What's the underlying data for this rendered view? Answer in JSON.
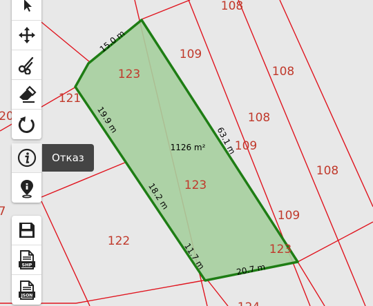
{
  "map": {
    "parcel_labels": [
      "108",
      "109",
      "108",
      "108",
      "109",
      "108",
      "109",
      "123",
      "121",
      "20",
      "123",
      "122",
      "7",
      "123",
      "124"
    ],
    "selected_parcel": {
      "area": "1126 m²",
      "edge_lengths": [
        "15.0 m",
        "19.9 m",
        "18.2 m",
        "11.7 m",
        "20.7 m",
        "63.1 m"
      ],
      "fill_color": "#a6cf9e",
      "outline_color": "#1e7d14"
    },
    "parcel_line_color": "#e0141e",
    "label_color": "#c0392b"
  },
  "toolbar": {
    "edit_tools": [
      "pointer-icon",
      "move-icon",
      "scissors-icon",
      "eraser-icon",
      "undo-icon"
    ],
    "info_tools": [
      "info-icon",
      "location-pin-icon"
    ],
    "file_tools": {
      "save": "save-icon",
      "shp_label": "SHP",
      "json_label": "JSON"
    }
  },
  "tooltip": {
    "text": "Отказ"
  }
}
